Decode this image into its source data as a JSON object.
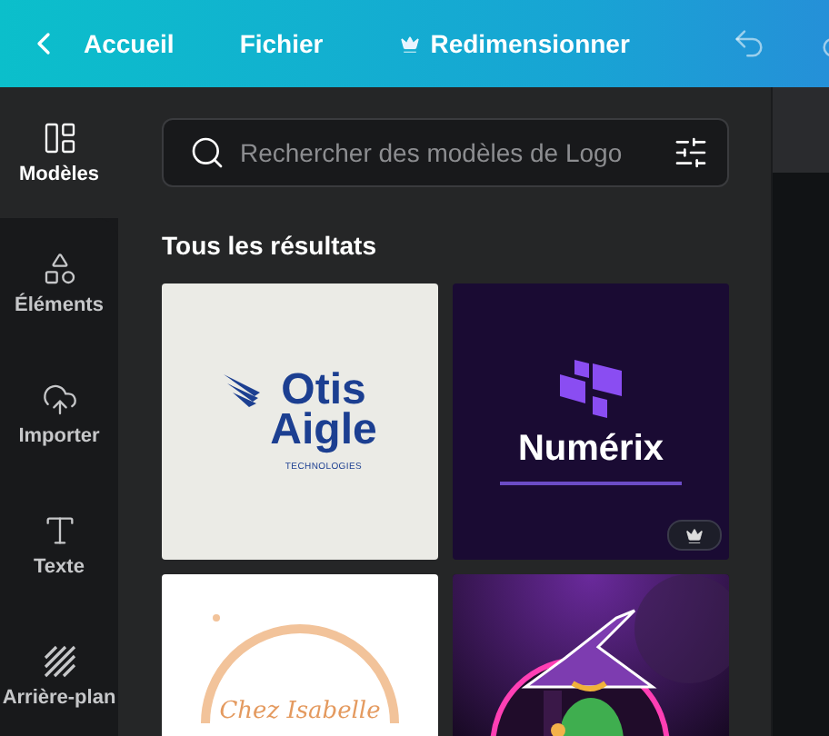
{
  "topbar": {
    "items": [
      {
        "kind": "back",
        "label": "Accueil"
      },
      {
        "kind": "plain",
        "label": "Fichier"
      },
      {
        "kind": "premium",
        "label": "Redimensionner"
      }
    ]
  },
  "sidebar": {
    "items": [
      {
        "kind": "templates",
        "label": "Modèles",
        "selected": true
      },
      {
        "kind": "elements",
        "label": "Éléments",
        "selected": false
      },
      {
        "kind": "upload",
        "label": "Importer",
        "selected": false
      },
      {
        "kind": "text",
        "label": "Texte",
        "selected": false
      },
      {
        "kind": "background",
        "label": "Arrière-plan",
        "selected": false
      }
    ]
  },
  "search": {
    "placeholder": "Rechercher des modèles de Logo"
  },
  "section_title": "Tous les résultats",
  "tiles": [
    {
      "kind": "wing-logo",
      "lines": [
        "Otis",
        "Aigle"
      ],
      "tagline": "TECHNOLOGIES",
      "premium": false
    },
    {
      "kind": "blocks-logo",
      "lines": [
        "Numérix"
      ],
      "premium": true
    },
    {
      "kind": "ring-logo",
      "lines": [
        "Chez Isabelle"
      ]
    },
    {
      "kind": "picture"
    }
  ]
}
